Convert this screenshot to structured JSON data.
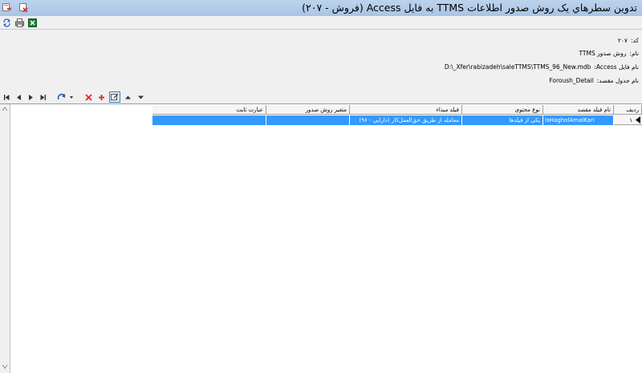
{
  "window": {
    "title": "تدوين سطرهاي يک روش صدور اطلاعات TTMS به فايل Access (فروش - ۲۰۷)"
  },
  "titlebar_icons": [
    "save-exit-icon",
    "close-form-icon"
  ],
  "toolbar": {
    "icons": [
      "refresh-icon",
      "print-icon",
      "excel-icon"
    ]
  },
  "form": {
    "code_label": "کد:",
    "code_value": "۲۰۷",
    "name_label": "نام:",
    "name_value": "روش صدور TTMS",
    "file_label": "نام فایل Access:",
    "file_value": "D:\\_Xfer\\rabizadeh\\saleTTMS\\TTMS_96_New.mdb",
    "table_label": "نام جدول مقصد:",
    "table_value": "Foroush_Detail"
  },
  "grid_toolbar": {
    "buttons": [
      "first-record",
      "prev-record",
      "next-record",
      "last-record",
      "action-menu",
      "delete",
      "add",
      "edit",
      "move-up",
      "move-down"
    ]
  },
  "grid": {
    "columns": [
      "رديف",
      "نام فيلد مقصد",
      "نوع محتوی",
      "فيلد مبداء",
      "متغير روش صدور",
      "عبارت ثابت"
    ],
    "rows": [
      {
        "index": "۱",
        "dest_field": "IsHagholAmalKari",
        "content_type": "يکی از فيلدها",
        "source_field": "معامله از طريق حق‌العمل‌کار (دارایی - ۹۶)",
        "export_variable": "",
        "constant": ""
      }
    ]
  }
}
